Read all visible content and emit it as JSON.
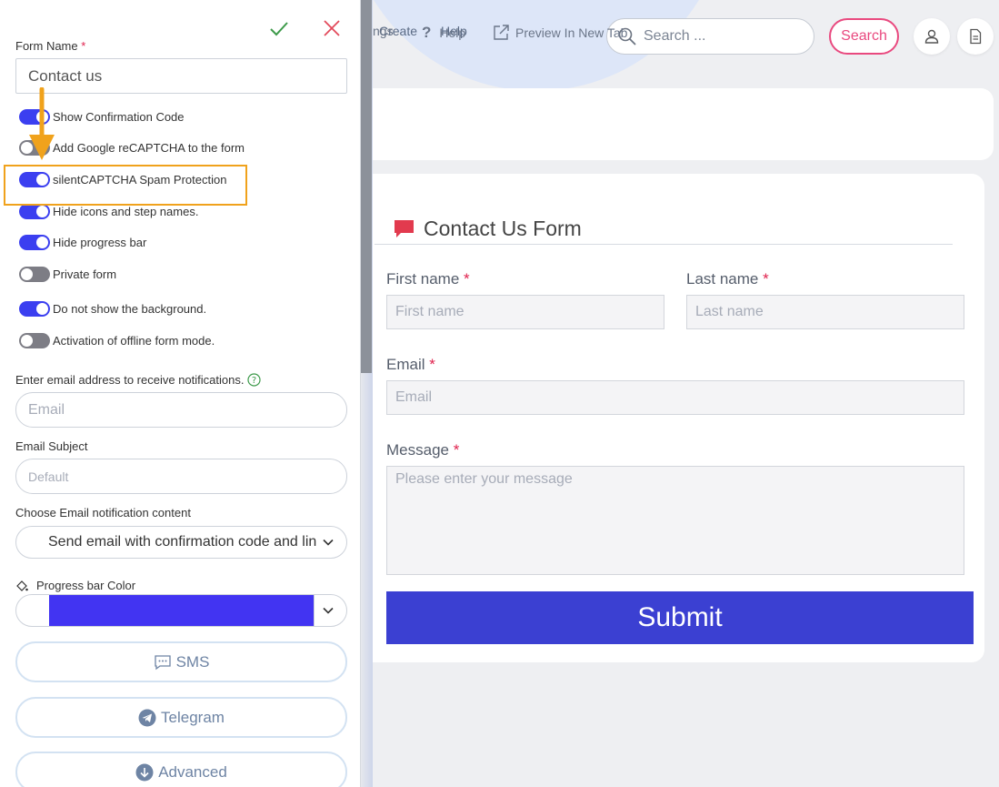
{
  "topnav": {
    "create": "Create",
    "help": "Help"
  },
  "search": {
    "placeholder": "Search ...",
    "button": "Search"
  },
  "toolbar": {
    "settings_partial": "ngs",
    "help": "Help",
    "preview": "Preview In New Tab"
  },
  "form": {
    "title": "Contact Us Form",
    "first_name": {
      "label": "First name",
      "required": "*",
      "placeholder": "First name"
    },
    "last_name": {
      "label": "Last name",
      "required": "*",
      "placeholder": "Last name"
    },
    "email": {
      "label": "Email",
      "required": "*",
      "placeholder": "Email"
    },
    "message": {
      "label": "Message",
      "required": "*",
      "placeholder": "Please enter your message"
    },
    "submit": "Submit"
  },
  "panel": {
    "form_name_label": "Form Name",
    "form_name_required": "*",
    "form_name_value": "Contact us",
    "toggles": [
      {
        "label": "Show Confirmation Code",
        "on": true
      },
      {
        "label": "Add Google reCAPTCHA to the form",
        "on": false
      },
      {
        "label": "silentCAPTCHA Spam Protection",
        "on": true
      },
      {
        "label": "Hide icons and step names.",
        "on": true
      },
      {
        "label": "Hide progress bar",
        "on": true
      },
      {
        "label": "Private form",
        "on": false
      },
      {
        "label": "Do not show the background.",
        "on": true
      },
      {
        "label": "Activation of offline form mode.",
        "on": false
      }
    ],
    "notify_label": "Enter email address to receive notifications.",
    "notify_placeholder": "Email",
    "subject_label": "Email Subject",
    "subject_placeholder": "Default",
    "content_label": "Choose Email notification content",
    "content_value": "Send email with confirmation code and link",
    "progress_color_label": "Progress bar Color",
    "progress_color": "#4234f2",
    "sms": "SMS",
    "telegram": "Telegram",
    "advanced": "Advanced"
  },
  "colors": {
    "accent": "#3b40d2",
    "toggle_on": "#3b3ff0",
    "highlight": "#f0a21c",
    "search_pink": "#e9497f"
  }
}
